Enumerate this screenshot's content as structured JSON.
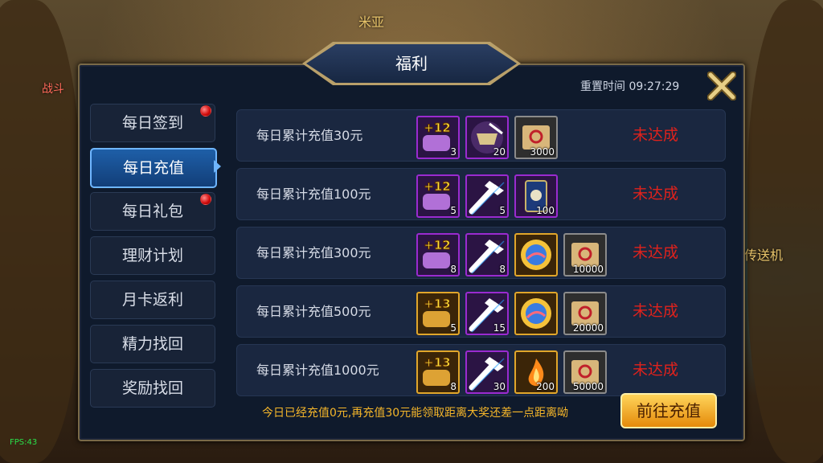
{
  "window": {
    "title": "福利",
    "reset_label": "重置时间 09:27:29"
  },
  "scene": {
    "npc_top": "米亚",
    "npc_right": "传送机",
    "left_sign": "战斗",
    "fps": "FPS:43"
  },
  "sidebar": {
    "items": [
      {
        "label": "每日签到",
        "badge": true,
        "active": false
      },
      {
        "label": "每日充值",
        "badge": false,
        "active": true
      },
      {
        "label": "每日礼包",
        "badge": true,
        "active": false
      },
      {
        "label": "理财计划",
        "badge": false,
        "active": false
      },
      {
        "label": "月卡返利",
        "badge": false,
        "active": false
      },
      {
        "label": "精力找回",
        "badge": false,
        "active": false
      },
      {
        "label": "奖励找回",
        "badge": false,
        "active": false
      }
    ]
  },
  "rows": [
    {
      "label": "每日累计充值30元",
      "status": "未达成",
      "rewards": [
        {
          "icon": "scroll-plus12-icon",
          "qty": "3"
        },
        {
          "icon": "treasure-chest-icon",
          "qty": "20"
        },
        {
          "icon": "gold-scroll-icon",
          "qty": "3000"
        }
      ]
    },
    {
      "label": "每日累计充值100元",
      "status": "未达成",
      "rewards": [
        {
          "icon": "scroll-plus12-icon",
          "qty": "5"
        },
        {
          "icon": "hammer-icon",
          "qty": "5"
        },
        {
          "icon": "card-icon",
          "qty": "100"
        }
      ]
    },
    {
      "label": "每日累计充值300元",
      "status": "未达成",
      "rewards": [
        {
          "icon": "scroll-plus12-icon",
          "qty": "8"
        },
        {
          "icon": "hammer-icon",
          "qty": "8"
        },
        {
          "icon": "orb-icon",
          "qty": ""
        },
        {
          "icon": "gold-scroll-icon",
          "qty": "10000"
        }
      ]
    },
    {
      "label": "每日累计充值500元",
      "status": "未达成",
      "rewards": [
        {
          "icon": "scroll-plus13-icon",
          "qty": "5"
        },
        {
          "icon": "hammer-icon",
          "qty": "15"
        },
        {
          "icon": "orb-icon",
          "qty": ""
        },
        {
          "icon": "gold-scroll-icon",
          "qty": "20000"
        }
      ]
    },
    {
      "label": "每日累计充值1000元",
      "status": "未达成",
      "rewards": [
        {
          "icon": "scroll-plus13-icon",
          "qty": "8"
        },
        {
          "icon": "hammer-icon",
          "qty": "30"
        },
        {
          "icon": "flame-icon",
          "qty": "200"
        },
        {
          "icon": "gold-scroll-icon",
          "qty": "50000"
        }
      ]
    }
  ],
  "footer": {
    "info": "今日已经充值0元,再充值30元能领取距离大奖还差一点距离呦",
    "button": "前往充值"
  },
  "colors": {
    "status": "#e0221c",
    "accent": "#1e5fa8",
    "button": "#f0a020"
  }
}
